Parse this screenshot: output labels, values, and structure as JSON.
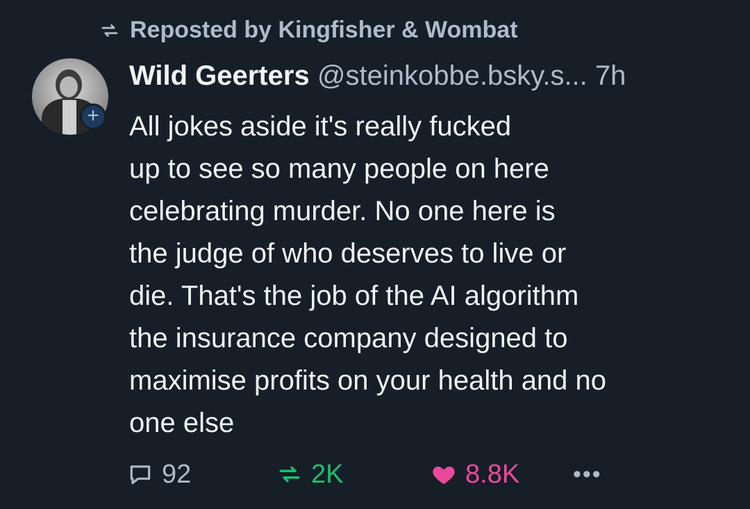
{
  "repost": {
    "label": "Reposted by Kingfisher & Wombat",
    "icon": "repost-icon"
  },
  "author": {
    "display_name": "Wild Geerters",
    "handle": "@steinkobbe.bsky.s...",
    "time": "7h",
    "avatar_icon": "avatar",
    "follow_label": "+"
  },
  "post": {
    "lines": [
      "All jokes aside it's really fucked",
      "up to see so many people on here",
      "celebrating murder. No one here is",
      "the judge of who deserves to live or",
      "die. That's the job of the AI algorithm",
      "the insurance company designed to",
      "maximise profits on your health and no",
      "one else"
    ]
  },
  "actions": {
    "replies": "92",
    "reposts": "2K",
    "likes": "8.8K",
    "more": "•••"
  },
  "colors": {
    "background": "#161e27",
    "muted": "#aebbc9",
    "repost_green": "#1bc06d",
    "like_pink": "#ec4899"
  }
}
